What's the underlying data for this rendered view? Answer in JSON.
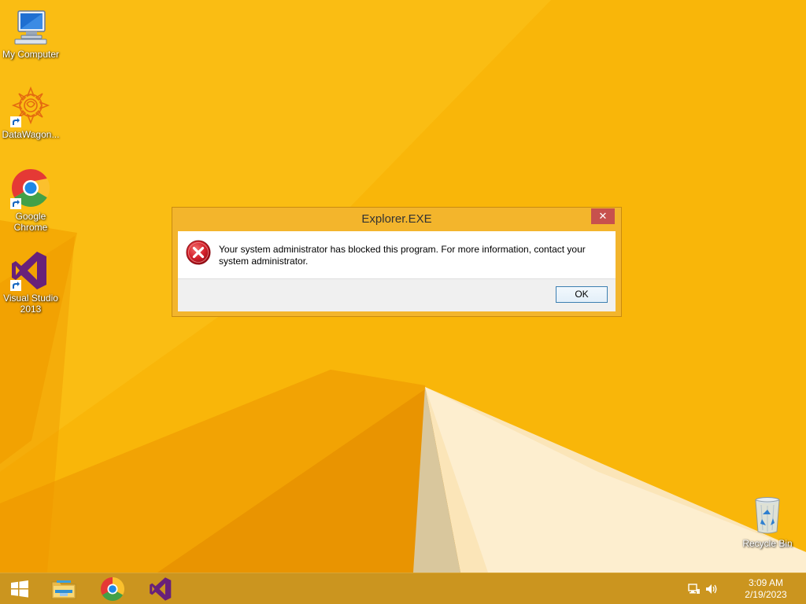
{
  "desktop": {
    "icons": [
      {
        "label": "My Computer",
        "icon": "computer-icon"
      },
      {
        "label": "DataWagon...",
        "icon": "datawagon-icon"
      },
      {
        "label": "Google\nChrome",
        "icon": "chrome-icon"
      },
      {
        "label": "Visual Studio\n2013",
        "icon": "visual-studio-icon"
      },
      {
        "label": "Recycle Bin",
        "icon": "recycle-bin-icon"
      }
    ]
  },
  "dialog": {
    "title": "Explorer.EXE",
    "close_symbol": "✕",
    "message": "Your system administrator has blocked this program. For more information, contact your system administrator.",
    "ok_label": "OK",
    "icon": "error-icon"
  },
  "taskbar": {
    "pinned": [
      {
        "icon": "start-icon"
      },
      {
        "icon": "file-explorer-icon"
      },
      {
        "icon": "chrome-icon"
      },
      {
        "icon": "visual-studio-icon"
      }
    ],
    "tray": {
      "icons": [
        "network-icon",
        "volume-icon"
      ],
      "time": "3:09 AM",
      "date": "2/19/2023"
    }
  },
  "colors": {
    "wallpaper": "#f8b400",
    "dialog_frame": "#f3b52c",
    "close_button": "#c7514d",
    "ok_border": "#3c7fb1",
    "taskbar": "#cb951f"
  }
}
